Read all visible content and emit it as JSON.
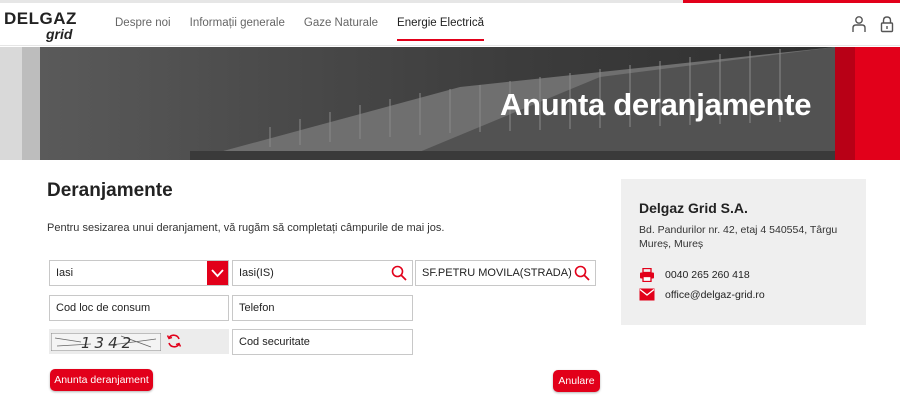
{
  "header": {
    "logo_top": "DELGAZ",
    "logo_bottom": "grid",
    "nav": [
      "Despre noi",
      "Informații generale",
      "Gaze Naturale",
      "Energie Electrică"
    ]
  },
  "hero": {
    "title": "Anunta deranjamente"
  },
  "main": {
    "heading": "Deranjamente",
    "intro": "Pentru sesizarea unui deranjament, vă rugăm să completați câmpurile de mai jos.",
    "county_value": "Iasi",
    "locality_value": "Iasi(IS)",
    "street_value": "SF.PETRU MOVILA(STRADA)",
    "consumption_placeholder": "Cod loc de consum",
    "phone_placeholder": "Telefon",
    "captcha_text": "1342",
    "security_placeholder": "Cod securitate",
    "submit_label": "Anunta deranjament",
    "cancel_label": "Anulare"
  },
  "contact": {
    "company": "Delgaz Grid S.A.",
    "address": "Bd. Pandurilor nr. 42, etaj 4 540554, Târgu Mureș, Mureș",
    "phone": "0040 265 260 418",
    "email": "office@delgaz-grid.ro"
  },
  "colors": {
    "brand_red": "#e2001a"
  },
  "icons": [
    "user-icon",
    "lock-icon",
    "search-icon",
    "chevron-down-icon",
    "refresh-icon",
    "printer-icon",
    "mail-icon"
  ]
}
